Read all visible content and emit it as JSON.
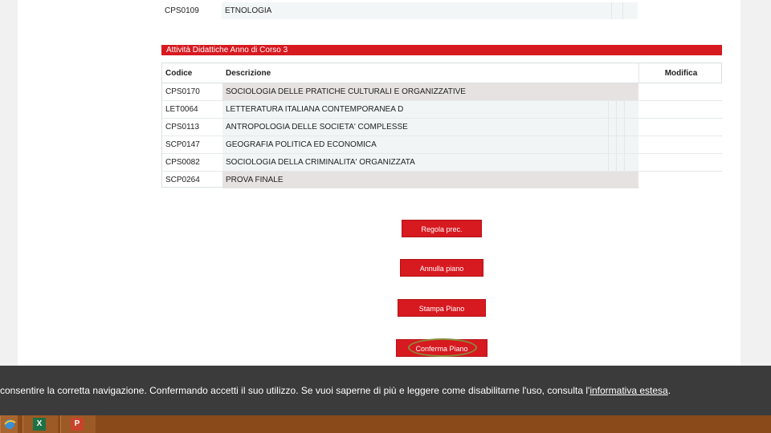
{
  "top_table": {
    "row": {
      "code": "CPS0109",
      "description": "ETNOLOGIA"
    }
  },
  "section": {
    "title": "Attività Didattiche   Anno di Corso 3"
  },
  "table": {
    "headers": {
      "code": "Codice",
      "description": "Descrizione",
      "edit": "Modifica"
    },
    "rows": [
      {
        "code": "CPS0170",
        "description": "SOCIOLOGIA DELLE PRATICHE CULTURALI E ORGANIZZATIVE"
      },
      {
        "code": "LET0064",
        "description": "LETTERATURA ITALIANA CONTEMPORANEA D"
      },
      {
        "code": "CPS0113",
        "description": "ANTROPOLOGIA DELLE SOCIETA' COMPLESSE"
      },
      {
        "code": "SCP0147",
        "description": "GEOGRAFIA POLITICA ED ECONOMICA"
      },
      {
        "code": "CPS0082",
        "description": "SOCIOLOGIA DELLA CRIMINALITA' ORGANIZZATA"
      },
      {
        "code": "SCP0264",
        "description": "PROVA FINALE"
      }
    ]
  },
  "buttons": {
    "regola": "Regola prec.",
    "annulla": "Annulla piano",
    "stampa": "Stampa  Piano",
    "conferma": "Conferma Piano"
  },
  "cookie_banner": {
    "text": "consentire la corretta navigazione. Confermando accetti il suo utilizzo. Se vuoi saperne di più e leggere come disabilitarne l'uso, consulta l'",
    "link": "informativa estesa",
    "suffix": "."
  },
  "taskbar": {
    "icons": [
      "internet-explorer-icon",
      "excel-icon",
      "powerpoint-icon"
    ]
  },
  "colors": {
    "accent": "#d71920",
    "banner": "#3b3b3b",
    "taskbar": "#8a4a1a"
  }
}
